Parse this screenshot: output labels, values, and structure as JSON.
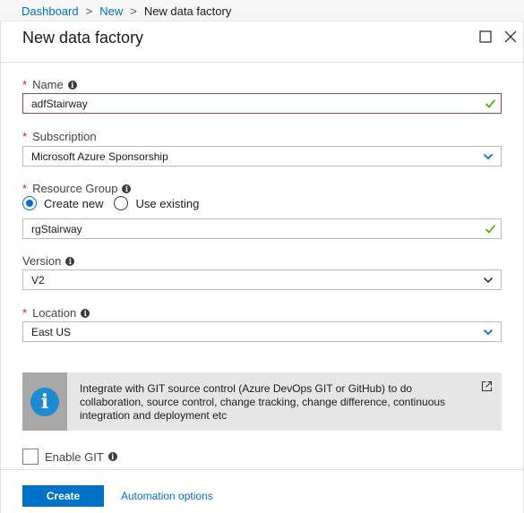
{
  "breadcrumb": {
    "items": [
      "Dashboard",
      "New"
    ],
    "current": "New data factory",
    "separator": ">"
  },
  "blade": {
    "title": "New data factory"
  },
  "form": {
    "name": {
      "label": "Name",
      "required": true,
      "value": "adfStairway",
      "valid": true
    },
    "subscription": {
      "label": "Subscription",
      "required": true,
      "value": "Microsoft Azure Sponsorship"
    },
    "resource_group": {
      "label": "Resource Group",
      "required": true,
      "options": [
        "Create new",
        "Use existing"
      ],
      "selected": "Create new",
      "value": "rgStairway",
      "valid": true
    },
    "version": {
      "label": "Version",
      "required": false,
      "value": "V2"
    },
    "location": {
      "label": "Location",
      "required": true,
      "value": "East US"
    }
  },
  "git_panel": {
    "info_glyph": "i",
    "text": "Integrate with GIT source control (Azure DevOps GIT or GitHub) to do collaboration, source control, change tracking, change difference, continuous integration and deployment etc"
  },
  "enable_git": {
    "label": "Enable GIT",
    "checked": false
  },
  "footer": {
    "create_label": "Create",
    "automation_label": "Automation options"
  },
  "colors": {
    "accent": "#0072c6",
    "required": "#d9172a",
    "valid": "#57a300",
    "focus_border": "#8a3f8f",
    "info_icon": "#1e8bd1"
  },
  "icons": {
    "info": "info-icon",
    "check": "checkmark-icon",
    "dropdown": "chevron-down-icon",
    "external": "external-link-icon",
    "maximize": "maximize-icon",
    "close": "close-icon"
  }
}
